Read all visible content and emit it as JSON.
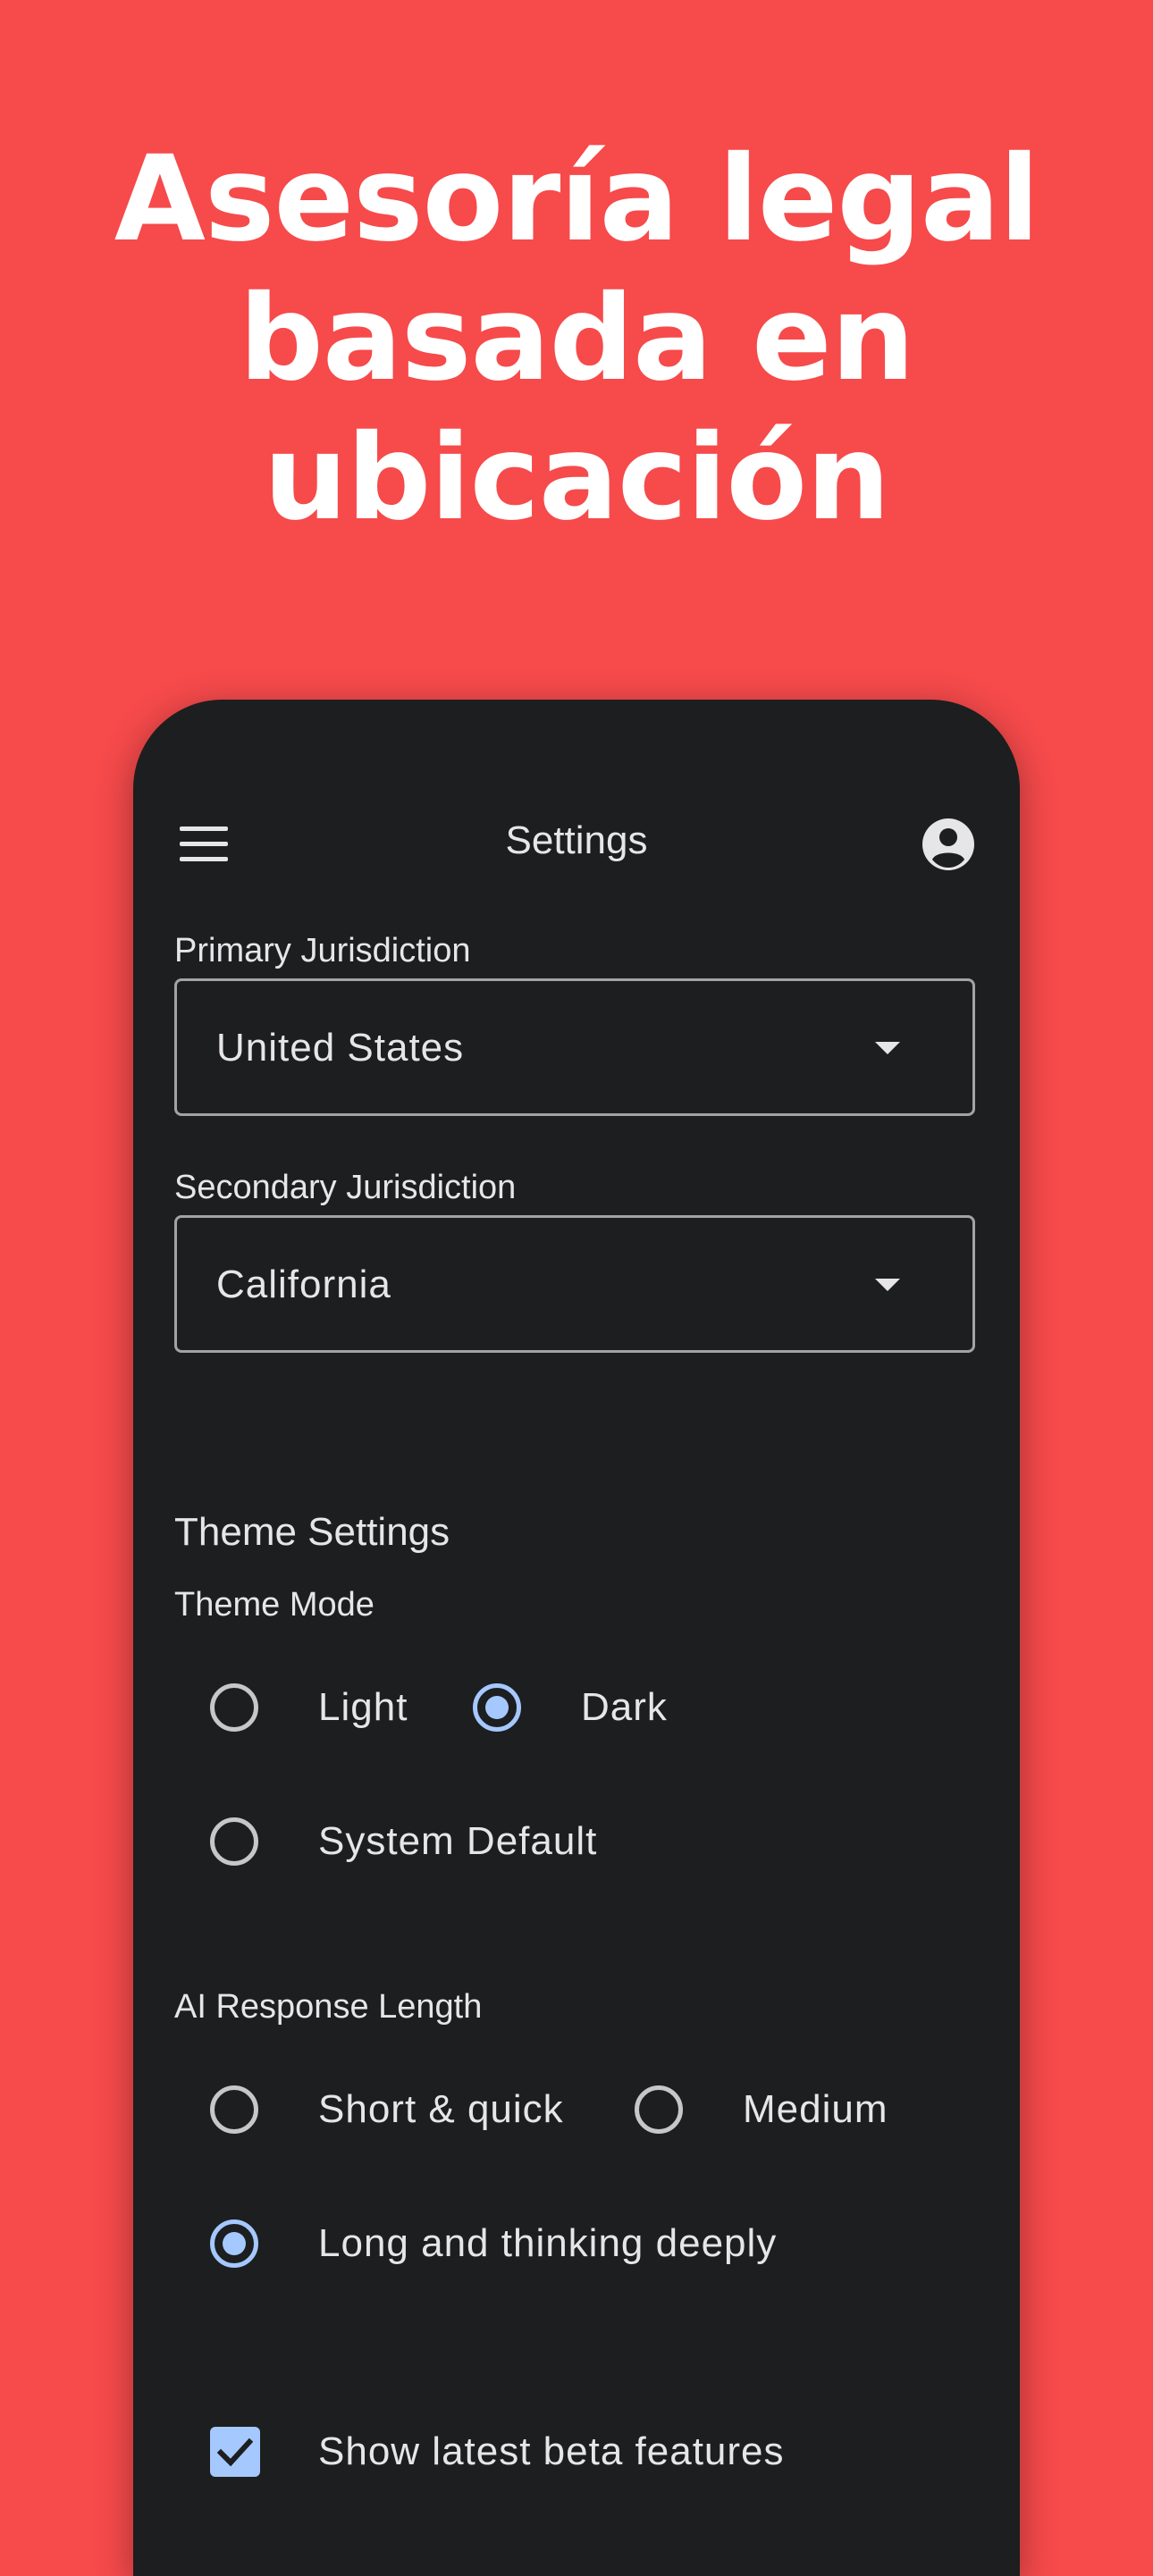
{
  "headline": {
    "lines": [
      "Asesoría legal",
      "basada en",
      "ubicación"
    ]
  },
  "appbar": {
    "title": "Settings",
    "menu_icon": "menu-icon",
    "account_icon": "account-circle-icon"
  },
  "jurisdiction": {
    "primary_label": "Primary Jurisdiction",
    "primary_value": "United States",
    "secondary_label": "Secondary Jurisdiction",
    "secondary_value": "California"
  },
  "theme": {
    "section_title": "Theme Settings",
    "mode_label": "Theme Mode",
    "options": [
      {
        "label": "Light",
        "selected": false
      },
      {
        "label": "Dark",
        "selected": true
      },
      {
        "label": "System Default",
        "selected": false
      }
    ]
  },
  "ai_response": {
    "label": "AI Response Length",
    "options": [
      {
        "label": "Short & quick",
        "selected": false
      },
      {
        "label": "Medium",
        "selected": false
      },
      {
        "label": "Long and thinking deeply",
        "selected": true
      }
    ]
  },
  "beta": {
    "label": "Show latest beta features",
    "checked": true
  },
  "colors": {
    "background": "#F64A4B",
    "surface": "#1D1E20",
    "accent": "#A5C8FF",
    "text": "#E6E6E8"
  }
}
